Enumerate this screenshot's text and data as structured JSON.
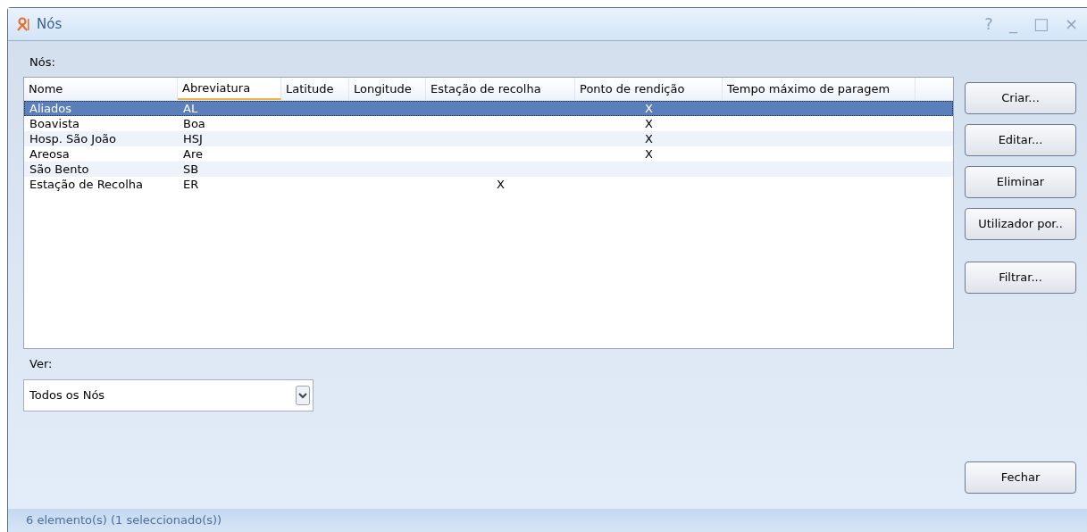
{
  "window": {
    "title": "Nós",
    "controls": [
      "?",
      "_",
      "□",
      "×"
    ]
  },
  "list_label": "Nós:",
  "table": {
    "columns": [
      {
        "label": "Nome",
        "sorted": false
      },
      {
        "label": "Abreviatura",
        "sorted": true
      },
      {
        "label": "Latitude",
        "sorted": false
      },
      {
        "label": "Longitude",
        "sorted": false
      },
      {
        "label": "Estação de recolha",
        "sorted": false
      },
      {
        "label": "Ponto de rendição",
        "sorted": false
      },
      {
        "label": "Tempo máximo de paragem",
        "sorted": false
      }
    ],
    "rows": [
      {
        "selected": true,
        "cells": [
          "Aliados",
          "AL",
          "",
          "",
          "",
          "X",
          ""
        ]
      },
      {
        "selected": false,
        "cells": [
          "Boavista",
          "Boa",
          "",
          "",
          "",
          "X",
          ""
        ]
      },
      {
        "selected": false,
        "cells": [
          "Hosp. São João",
          "HSJ",
          "",
          "",
          "",
          "X",
          ""
        ]
      },
      {
        "selected": false,
        "cells": [
          "Areosa",
          "Are",
          "",
          "",
          "",
          "X",
          ""
        ]
      },
      {
        "selected": false,
        "cells": [
          "São Bento",
          "SB",
          "",
          "",
          "",
          "",
          ""
        ]
      },
      {
        "selected": false,
        "cells": [
          "Estação de Recolha",
          "ER",
          "",
          "",
          "X",
          "",
          ""
        ]
      }
    ]
  },
  "side_buttons": [
    {
      "label": "Criar...",
      "kind": "button"
    },
    {
      "label": "Editar...",
      "kind": "button"
    },
    {
      "label": "Eliminar",
      "kind": "button"
    },
    {
      "label": "Utilizador por..",
      "kind": "button"
    },
    {
      "kind": "gap"
    },
    {
      "label": "Filtrar...",
      "kind": "button"
    }
  ],
  "view": {
    "label": "Ver:",
    "value": "Todos os Nós"
  },
  "close_button": "Fechar",
  "status_bar": "6 elemento(s) (1 seleccionado(s))"
}
